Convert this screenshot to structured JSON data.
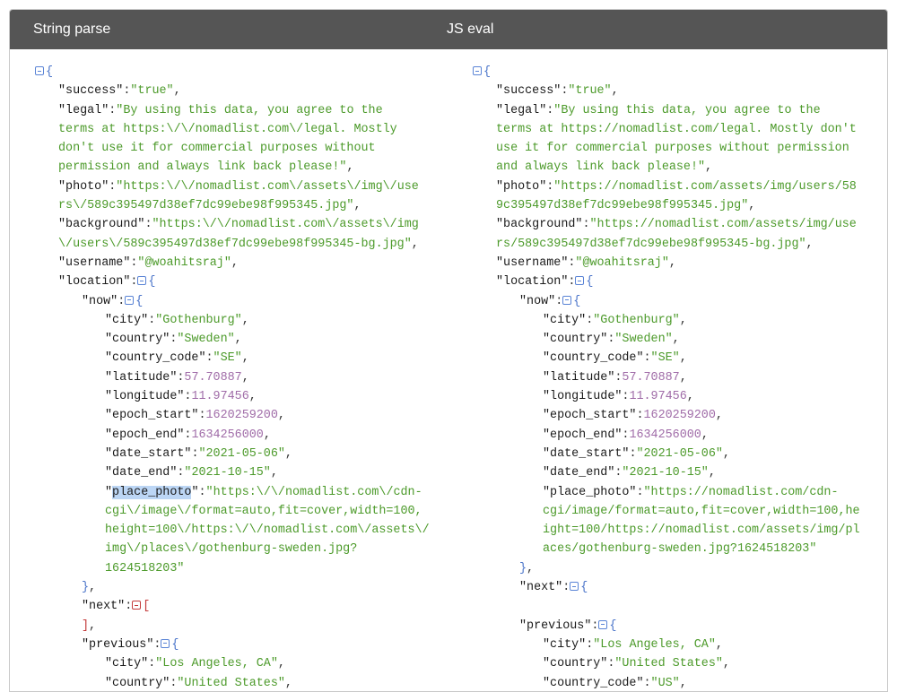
{
  "headers": {
    "left": "String parse",
    "right": "JS eval"
  },
  "left_lines": [
    {
      "i": 0,
      "t": [
        {
          "tog": "blue"
        },
        {
          "b": "{"
        }
      ]
    },
    {
      "i": 1,
      "t": [
        {
          "k": "\"success\""
        },
        {
          "p": ":"
        },
        {
          "s": "\"true\""
        },
        {
          "p": ","
        }
      ]
    },
    {
      "i": 1,
      "t": [
        {
          "k": "\"legal\""
        },
        {
          "p": ":"
        },
        {
          "s": "\"By using this data, you agree to the"
        }
      ]
    },
    {
      "i": 1,
      "t": [
        {
          "s": "terms at https:\\/\\/nomadlist.com\\/legal. Mostly"
        }
      ]
    },
    {
      "i": 1,
      "t": [
        {
          "s": "don't use it for commercial purposes without"
        }
      ]
    },
    {
      "i": 1,
      "t": [
        {
          "s": "permission and always link back please!\""
        },
        {
          "p": ","
        }
      ]
    },
    {
      "i": 1,
      "t": [
        {
          "k": "\"photo\""
        },
        {
          "p": ":"
        },
        {
          "s": "\"https:\\/\\/nomadlist.com\\/assets\\/img\\/use"
        }
      ]
    },
    {
      "i": 1,
      "t": [
        {
          "s": "rs\\/589c395497d38ef7dc99ebe98f995345.jpg\""
        },
        {
          "p": ","
        }
      ]
    },
    {
      "i": 1,
      "t": [
        {
          "k": "\"background\""
        },
        {
          "p": ":"
        },
        {
          "s": "\"https:\\/\\/nomadlist.com\\/assets\\/img"
        }
      ]
    },
    {
      "i": 1,
      "t": [
        {
          "s": "\\/users\\/589c395497d38ef7dc99ebe98f995345-bg.jpg\""
        },
        {
          "p": ","
        }
      ]
    },
    {
      "i": 1,
      "t": [
        {
          "k": "\"username\""
        },
        {
          "p": ":"
        },
        {
          "s": "\"@woahitsraj\""
        },
        {
          "p": ","
        }
      ]
    },
    {
      "i": 1,
      "t": [
        {
          "k": "\"location\""
        },
        {
          "p": ":"
        },
        {
          "tog": "blue"
        },
        {
          "b": "{"
        }
      ]
    },
    {
      "i": 2,
      "t": [
        {
          "k": "\"now\""
        },
        {
          "p": ":"
        },
        {
          "tog": "blue"
        },
        {
          "b": "{"
        }
      ]
    },
    {
      "i": 3,
      "t": [
        {
          "k": "\"city\""
        },
        {
          "p": ":"
        },
        {
          "s": "\"Gothenburg\""
        },
        {
          "p": ","
        }
      ]
    },
    {
      "i": 3,
      "t": [
        {
          "k": "\"country\""
        },
        {
          "p": ":"
        },
        {
          "s": "\"Sweden\""
        },
        {
          "p": ","
        }
      ]
    },
    {
      "i": 3,
      "t": [
        {
          "k": "\"country_code\""
        },
        {
          "p": ":"
        },
        {
          "s": "\"SE\""
        },
        {
          "p": ","
        }
      ]
    },
    {
      "i": 3,
      "t": [
        {
          "k": "\"latitude\""
        },
        {
          "p": ":"
        },
        {
          "n": "57.70887"
        },
        {
          "p": ","
        }
      ]
    },
    {
      "i": 3,
      "t": [
        {
          "k": "\"longitude\""
        },
        {
          "p": ":"
        },
        {
          "n": "11.97456"
        },
        {
          "p": ","
        }
      ]
    },
    {
      "i": 3,
      "t": [
        {
          "k": "\"epoch_start\""
        },
        {
          "p": ":"
        },
        {
          "n": "1620259200"
        },
        {
          "p": ","
        }
      ]
    },
    {
      "i": 3,
      "t": [
        {
          "k": "\"epoch_end\""
        },
        {
          "p": ":"
        },
        {
          "n": "1634256000"
        },
        {
          "p": ","
        }
      ]
    },
    {
      "i": 3,
      "t": [
        {
          "k": "\"date_start\""
        },
        {
          "p": ":"
        },
        {
          "s": "\"2021-05-06\""
        },
        {
          "p": ","
        }
      ]
    },
    {
      "i": 3,
      "t": [
        {
          "k": "\"date_end\""
        },
        {
          "p": ":"
        },
        {
          "s": "\"2021-10-15\""
        },
        {
          "p": ","
        }
      ]
    },
    {
      "i": 3,
      "t": [
        {
          "k": "\""
        },
        {
          "hl": "place_photo"
        },
        {
          "k": "\""
        },
        {
          "p": ":"
        },
        {
          "s": "\"https:\\/\\/nomadlist.com\\/cdn-"
        }
      ]
    },
    {
      "i": 3,
      "t": [
        {
          "s": "cgi\\/image\\/format=auto,fit=cover,width=100,"
        }
      ]
    },
    {
      "i": 3,
      "t": [
        {
          "s": "height=100\\/https:\\/\\/nomadlist.com\\/assets\\/"
        }
      ]
    },
    {
      "i": 3,
      "t": [
        {
          "s": "img\\/places\\/gothenburg-sweden.jpg?"
        }
      ]
    },
    {
      "i": 3,
      "t": [
        {
          "s": "1624518203\""
        }
      ]
    },
    {
      "i": 2,
      "t": [
        {
          "b": "}"
        },
        {
          "p": ","
        }
      ]
    },
    {
      "i": 2,
      "t": [
        {
          "k": "\"next\""
        },
        {
          "p": ":"
        },
        {
          "tog": "red"
        },
        {
          "br": "["
        }
      ]
    },
    {
      "i": 2,
      "t": [
        {
          "br": "]"
        },
        {
          "p": ","
        }
      ]
    },
    {
      "i": 2,
      "t": [
        {
          "k": "\"previous\""
        },
        {
          "p": ":"
        },
        {
          "tog": "blue"
        },
        {
          "b": "{"
        }
      ]
    },
    {
      "i": 3,
      "t": [
        {
          "k": "\"city\""
        },
        {
          "p": ":"
        },
        {
          "s": "\"Los Angeles, CA\""
        },
        {
          "p": ","
        }
      ]
    },
    {
      "i": 3,
      "t": [
        {
          "k": "\"country\""
        },
        {
          "p": ":"
        },
        {
          "s": "\"United States\""
        },
        {
          "p": ","
        }
      ]
    }
  ],
  "right_lines": [
    {
      "i": 0,
      "t": [
        {
          "tog": "blue"
        },
        {
          "b": "{"
        }
      ]
    },
    {
      "i": 1,
      "t": [
        {
          "k": "\"success\""
        },
        {
          "p": ":"
        },
        {
          "s": "\"true\""
        },
        {
          "p": ","
        }
      ]
    },
    {
      "i": 1,
      "t": [
        {
          "k": "\"legal\""
        },
        {
          "p": ":"
        },
        {
          "s": "\"By using this data, you agree to the"
        }
      ]
    },
    {
      "i": 1,
      "t": [
        {
          "s": "terms at https://nomadlist.com/legal. Mostly don't"
        }
      ]
    },
    {
      "i": 1,
      "t": [
        {
          "s": "use it for commercial purposes without permission"
        }
      ]
    },
    {
      "i": 1,
      "t": [
        {
          "s": "and always link back please!\""
        },
        {
          "p": ","
        }
      ]
    },
    {
      "i": 1,
      "t": [
        {
          "k": "\"photo\""
        },
        {
          "p": ":"
        },
        {
          "s": "\"https://nomadlist.com/assets/img/users/58"
        }
      ]
    },
    {
      "i": 1,
      "t": [
        {
          "s": "9c395497d38ef7dc99ebe98f995345.jpg\""
        },
        {
          "p": ","
        }
      ]
    },
    {
      "i": 1,
      "t": [
        {
          "k": "\"background\""
        },
        {
          "p": ":"
        },
        {
          "s": "\"https://nomadlist.com/assets/img/use"
        }
      ]
    },
    {
      "i": 1,
      "t": [
        {
          "s": "rs/589c395497d38ef7dc99ebe98f995345-bg.jpg\""
        },
        {
          "p": ","
        }
      ]
    },
    {
      "i": 1,
      "t": [
        {
          "k": "\"username\""
        },
        {
          "p": ":"
        },
        {
          "s": "\"@woahitsraj\""
        },
        {
          "p": ","
        }
      ]
    },
    {
      "i": 1,
      "t": [
        {
          "k": "\"location\""
        },
        {
          "p": ":"
        },
        {
          "tog": "blue"
        },
        {
          "b": "{"
        }
      ]
    },
    {
      "i": 2,
      "t": [
        {
          "k": "\"now\""
        },
        {
          "p": ":"
        },
        {
          "tog": "blue"
        },
        {
          "b": "{"
        }
      ]
    },
    {
      "i": 3,
      "t": [
        {
          "k": "\"city\""
        },
        {
          "p": ":"
        },
        {
          "s": "\"Gothenburg\""
        },
        {
          "p": ","
        }
      ]
    },
    {
      "i": 3,
      "t": [
        {
          "k": "\"country\""
        },
        {
          "p": ":"
        },
        {
          "s": "\"Sweden\""
        },
        {
          "p": ","
        }
      ]
    },
    {
      "i": 3,
      "t": [
        {
          "k": "\"country_code\""
        },
        {
          "p": ":"
        },
        {
          "s": "\"SE\""
        },
        {
          "p": ","
        }
      ]
    },
    {
      "i": 3,
      "t": [
        {
          "k": "\"latitude\""
        },
        {
          "p": ":"
        },
        {
          "n": "57.70887"
        },
        {
          "p": ","
        }
      ]
    },
    {
      "i": 3,
      "t": [
        {
          "k": "\"longitude\""
        },
        {
          "p": ":"
        },
        {
          "n": "11.97456"
        },
        {
          "p": ","
        }
      ]
    },
    {
      "i": 3,
      "t": [
        {
          "k": "\"epoch_start\""
        },
        {
          "p": ":"
        },
        {
          "n": "1620259200"
        },
        {
          "p": ","
        }
      ]
    },
    {
      "i": 3,
      "t": [
        {
          "k": "\"epoch_end\""
        },
        {
          "p": ":"
        },
        {
          "n": "1634256000"
        },
        {
          "p": ","
        }
      ]
    },
    {
      "i": 3,
      "t": [
        {
          "k": "\"date_start\""
        },
        {
          "p": ":"
        },
        {
          "s": "\"2021-05-06\""
        },
        {
          "p": ","
        }
      ]
    },
    {
      "i": 3,
      "t": [
        {
          "k": "\"date_end\""
        },
        {
          "p": ":"
        },
        {
          "s": "\"2021-10-15\""
        },
        {
          "p": ","
        }
      ]
    },
    {
      "i": 3,
      "t": [
        {
          "k": "\"place_photo\""
        },
        {
          "p": ":"
        },
        {
          "s": "\"https://nomadlist.com/cdn-"
        }
      ]
    },
    {
      "i": 3,
      "t": [
        {
          "s": "cgi/image/format=auto,fit=cover,width=100,he"
        }
      ]
    },
    {
      "i": 3,
      "t": [
        {
          "s": "ight=100/https://nomadlist.com/assets/img/pl"
        }
      ]
    },
    {
      "i": 3,
      "t": [
        {
          "s": "aces/gothenburg-sweden.jpg?1624518203\""
        }
      ]
    },
    {
      "i": 2,
      "t": [
        {
          "b": "}"
        },
        {
          "p": ","
        }
      ]
    },
    {
      "i": 2,
      "t": [
        {
          "k": "\"next\""
        },
        {
          "p": ":"
        },
        {
          "tog": "blue"
        },
        {
          "b": "{"
        }
      ]
    },
    {
      "i": 2,
      "t": []
    },
    {
      "i": 2,
      "t": [
        {
          "k": "\"previous\""
        },
        {
          "p": ":"
        },
        {
          "tog": "blue"
        },
        {
          "b": "{"
        }
      ]
    },
    {
      "i": 3,
      "t": [
        {
          "k": "\"city\""
        },
        {
          "p": ":"
        },
        {
          "s": "\"Los Angeles, CA\""
        },
        {
          "p": ","
        }
      ]
    },
    {
      "i": 3,
      "t": [
        {
          "k": "\"country\""
        },
        {
          "p": ":"
        },
        {
          "s": "\"United States\""
        },
        {
          "p": ","
        }
      ]
    },
    {
      "i": 3,
      "t": [
        {
          "k": "\"country_code\""
        },
        {
          "p": ":"
        },
        {
          "s": "\"US\""
        },
        {
          "p": ","
        }
      ]
    }
  ],
  "colors": {
    "header_bg": "#555555",
    "string": "#4c9a2a",
    "number": "#a06ca8",
    "brace": "#4a74c9",
    "array_bracket": "#c43b3b",
    "selection": "#bcd6f5"
  }
}
